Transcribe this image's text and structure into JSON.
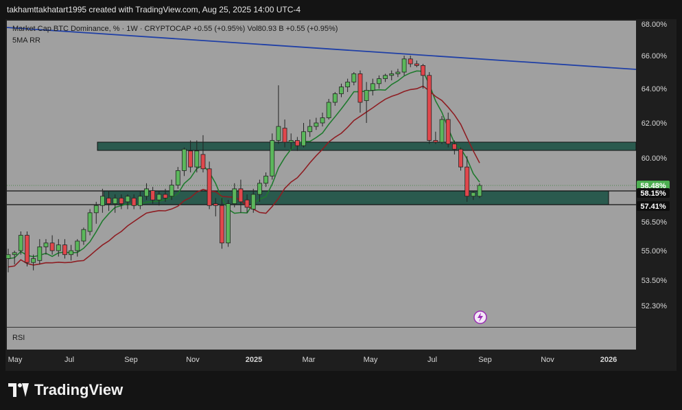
{
  "header": {
    "text": "takhamttakhatart1995 created with TradingView.com, Aug 25, 2025 14:00 UTC-4"
  },
  "legend": {
    "line1": "Market Cap BTC Dominance, % · 1W · CRYPTOCAP  +0.55 (+0.95%)  Vol80.93 B  +0.55 (+0.95%)",
    "line2": "5MA RR"
  },
  "rsi_label": "RSI",
  "brand": "TradingView",
  "colors": {
    "plot_bg": "#a0a0a0",
    "up": "#5bb75b",
    "down": "#e0474c",
    "ma_fast": "#1f7a2e",
    "ma_slow": "#8e1d22",
    "trend": "#1f3fa6",
    "zone": "#2a5a4e",
    "price_tag": "#4caf50"
  },
  "chart_data": {
    "type": "candlestick",
    "y_axis_ticks": [
      "68.00%",
      "66.00%",
      "64.00%",
      "62.00%",
      "60.00%",
      "56.50%",
      "55.00%",
      "53.50%",
      "52.30%"
    ],
    "x_axis_ticks": [
      "May",
      "Jul",
      "Sep",
      "Nov",
      "2025",
      "Mar",
      "May",
      "Jul",
      "Sep",
      "Nov",
      "2026"
    ],
    "price_labels": [
      {
        "text": "58.48%",
        "kind": "last"
      },
      {
        "text": "58.15%",
        "kind": "level"
      },
      {
        "text": "57.41%",
        "kind": "level"
      }
    ],
    "candles": [
      {
        "o": 54.6,
        "h": 55.1,
        "l": 53.9,
        "c": 54.8
      },
      {
        "o": 54.8,
        "h": 55.0,
        "l": 54.3,
        "c": 54.9
      },
      {
        "o": 55.0,
        "h": 56.0,
        "l": 54.8,
        "c": 55.8
      },
      {
        "o": 55.8,
        "h": 56.0,
        "l": 54.2,
        "c": 54.4
      },
      {
        "o": 54.4,
        "h": 54.8,
        "l": 54.0,
        "c": 54.6
      },
      {
        "o": 54.5,
        "h": 55.6,
        "l": 54.3,
        "c": 55.2
      },
      {
        "o": 55.2,
        "h": 55.6,
        "l": 54.8,
        "c": 55.4
      },
      {
        "o": 55.4,
        "h": 55.8,
        "l": 54.8,
        "c": 55.0
      },
      {
        "o": 55.0,
        "h": 55.6,
        "l": 54.7,
        "c": 55.3
      },
      {
        "o": 55.3,
        "h": 55.6,
        "l": 54.6,
        "c": 54.8
      },
      {
        "o": 54.8,
        "h": 55.3,
        "l": 54.5,
        "c": 55.0
      },
      {
        "o": 55.0,
        "h": 55.6,
        "l": 54.7,
        "c": 55.5
      },
      {
        "o": 55.5,
        "h": 56.2,
        "l": 55.3,
        "c": 56.1
      },
      {
        "o": 56.0,
        "h": 57.2,
        "l": 55.8,
        "c": 57.0
      },
      {
        "o": 57.0,
        "h": 57.6,
        "l": 56.4,
        "c": 57.4
      },
      {
        "o": 57.4,
        "h": 58.3,
        "l": 57.0,
        "c": 57.9
      },
      {
        "o": 57.8,
        "h": 58.2,
        "l": 57.1,
        "c": 57.5
      },
      {
        "o": 57.5,
        "h": 58.0,
        "l": 57.0,
        "c": 57.8
      },
      {
        "o": 57.8,
        "h": 58.0,
        "l": 57.2,
        "c": 57.5
      },
      {
        "o": 57.6,
        "h": 58.0,
        "l": 57.2,
        "c": 57.9
      },
      {
        "o": 57.8,
        "h": 58.0,
        "l": 57.2,
        "c": 57.4
      },
      {
        "o": 57.4,
        "h": 58.2,
        "l": 57.2,
        "c": 57.9
      },
      {
        "o": 57.9,
        "h": 58.6,
        "l": 57.7,
        "c": 58.3
      },
      {
        "o": 58.2,
        "h": 58.4,
        "l": 57.5,
        "c": 57.7
      },
      {
        "o": 57.7,
        "h": 58.2,
        "l": 57.4,
        "c": 58.0
      },
      {
        "o": 58.0,
        "h": 58.3,
        "l": 57.6,
        "c": 57.8
      },
      {
        "o": 57.9,
        "h": 58.8,
        "l": 57.7,
        "c": 58.5
      },
      {
        "o": 58.5,
        "h": 59.5,
        "l": 58.3,
        "c": 59.3
      },
      {
        "o": 59.3,
        "h": 60.6,
        "l": 59.0,
        "c": 60.5
      },
      {
        "o": 60.4,
        "h": 61.0,
        "l": 59.2,
        "c": 59.5
      },
      {
        "o": 59.5,
        "h": 61.0,
        "l": 59.2,
        "c": 60.4
      },
      {
        "o": 60.2,
        "h": 61.3,
        "l": 59.2,
        "c": 59.4
      },
      {
        "o": 59.4,
        "h": 59.8,
        "l": 57.2,
        "c": 57.4
      },
      {
        "o": 57.5,
        "h": 57.8,
        "l": 56.8,
        "c": 57.4
      },
      {
        "o": 57.4,
        "h": 57.8,
        "l": 55.1,
        "c": 55.4
      },
      {
        "o": 55.4,
        "h": 57.7,
        "l": 55.2,
        "c": 57.5
      },
      {
        "o": 57.5,
        "h": 58.6,
        "l": 57.3,
        "c": 58.3
      },
      {
        "o": 58.3,
        "h": 58.8,
        "l": 57.0,
        "c": 57.6
      },
      {
        "o": 57.7,
        "h": 58.0,
        "l": 57.0,
        "c": 57.3
      },
      {
        "o": 57.2,
        "h": 58.3,
        "l": 57.0,
        "c": 58.0
      },
      {
        "o": 58.0,
        "h": 58.8,
        "l": 57.6,
        "c": 58.6
      },
      {
        "o": 58.6,
        "h": 59.2,
        "l": 58.4,
        "c": 59.0
      },
      {
        "o": 59.0,
        "h": 61.4,
        "l": 58.8,
        "c": 61.0
      },
      {
        "o": 61.0,
        "h": 64.2,
        "l": 60.8,
        "c": 61.8
      },
      {
        "o": 61.7,
        "h": 62.2,
        "l": 60.6,
        "c": 60.9
      },
      {
        "o": 60.9,
        "h": 61.4,
        "l": 60.5,
        "c": 61.0
      },
      {
        "o": 61.0,
        "h": 61.2,
        "l": 60.4,
        "c": 60.7
      },
      {
        "o": 60.7,
        "h": 62.0,
        "l": 60.6,
        "c": 61.5
      },
      {
        "o": 61.5,
        "h": 62.2,
        "l": 61.2,
        "c": 61.8
      },
      {
        "o": 61.8,
        "h": 62.3,
        "l": 61.6,
        "c": 62.0
      },
      {
        "o": 62.0,
        "h": 62.6,
        "l": 61.8,
        "c": 62.3
      },
      {
        "o": 62.3,
        "h": 63.4,
        "l": 62.2,
        "c": 63.2
      },
      {
        "o": 63.2,
        "h": 63.8,
        "l": 63.0,
        "c": 63.7
      },
      {
        "o": 63.7,
        "h": 64.3,
        "l": 63.5,
        "c": 64.1
      },
      {
        "o": 64.1,
        "h": 64.6,
        "l": 63.8,
        "c": 64.4
      },
      {
        "o": 64.4,
        "h": 65.0,
        "l": 64.2,
        "c": 64.9
      },
      {
        "o": 64.9,
        "h": 65.1,
        "l": 62.6,
        "c": 63.2
      },
      {
        "o": 63.3,
        "h": 64.4,
        "l": 62.0,
        "c": 63.9
      },
      {
        "o": 63.9,
        "h": 64.6,
        "l": 63.6,
        "c": 64.3
      },
      {
        "o": 64.3,
        "h": 64.8,
        "l": 64.0,
        "c": 64.6
      },
      {
        "o": 64.6,
        "h": 64.9,
        "l": 64.4,
        "c": 64.8
      },
      {
        "o": 64.8,
        "h": 65.1,
        "l": 64.5,
        "c": 64.9
      },
      {
        "o": 64.9,
        "h": 65.2,
        "l": 64.7,
        "c": 65.0
      },
      {
        "o": 65.0,
        "h": 66.0,
        "l": 64.8,
        "c": 65.8
      },
      {
        "o": 65.8,
        "h": 66.0,
        "l": 65.3,
        "c": 65.5
      },
      {
        "o": 65.5,
        "h": 65.7,
        "l": 65.3,
        "c": 65.4
      },
      {
        "o": 65.4,
        "h": 65.5,
        "l": 64.0,
        "c": 64.8
      },
      {
        "o": 64.8,
        "h": 65.0,
        "l": 60.8,
        "c": 61.0
      },
      {
        "o": 61.0,
        "h": 61.5,
        "l": 60.8,
        "c": 60.9
      },
      {
        "o": 60.9,
        "h": 62.4,
        "l": 60.8,
        "c": 62.2
      },
      {
        "o": 62.2,
        "h": 62.6,
        "l": 60.6,
        "c": 60.8
      },
      {
        "o": 60.8,
        "h": 61.0,
        "l": 60.2,
        "c": 60.5
      },
      {
        "o": 60.5,
        "h": 60.6,
        "l": 59.3,
        "c": 59.5
      },
      {
        "o": 59.5,
        "h": 60.1,
        "l": 57.6,
        "c": 57.9
      },
      {
        "o": 57.9,
        "h": 58.2,
        "l": 57.7,
        "c": 58.1
      },
      {
        "o": 57.9,
        "h": 58.6,
        "l": 57.8,
        "c": 58.48
      }
    ]
  }
}
